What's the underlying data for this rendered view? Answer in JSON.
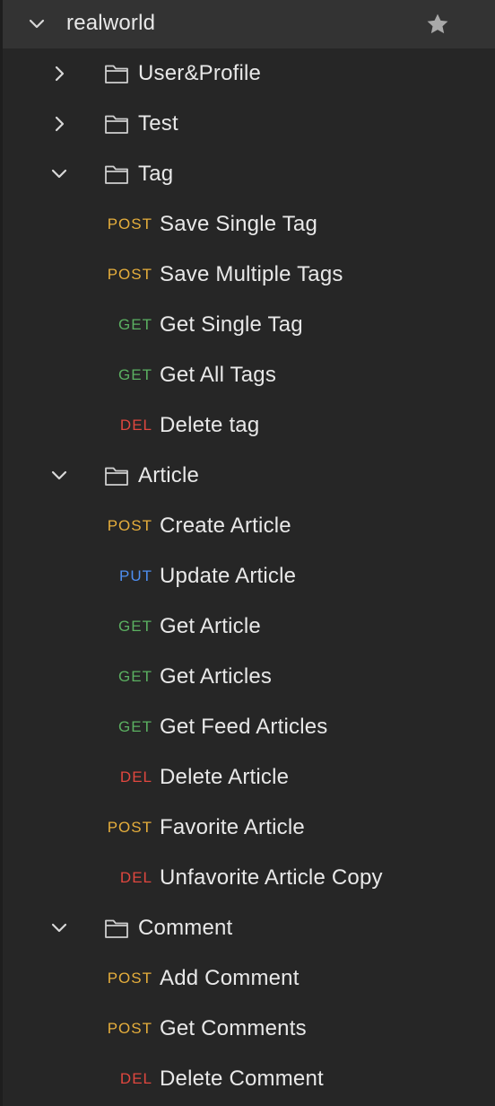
{
  "collection": {
    "name": "realworld",
    "expanded": true,
    "chevron_icon": "chevron-down-icon",
    "star_icon": "star-icon"
  },
  "colors": {
    "background": "#262626",
    "collection_row_bg": "#333333",
    "text": "#e8e8e8",
    "POST": "#e6ae3c",
    "GET": "#5bb061",
    "PUT": "#4d8ef0",
    "DEL": "#e0473f"
  },
  "folders": [
    {
      "name": "User&Profile",
      "expanded": false,
      "requests": []
    },
    {
      "name": "Test",
      "expanded": false,
      "requests": []
    },
    {
      "name": "Tag",
      "expanded": true,
      "requests": [
        {
          "method": "POST",
          "name": "Save Single Tag"
        },
        {
          "method": "POST",
          "name": "Save Multiple Tags"
        },
        {
          "method": "GET",
          "name": "Get Single Tag"
        },
        {
          "method": "GET",
          "name": "Get All Tags"
        },
        {
          "method": "DEL",
          "name": "Delete tag"
        }
      ]
    },
    {
      "name": "Article",
      "expanded": true,
      "requests": [
        {
          "method": "POST",
          "name": "Create Article"
        },
        {
          "method": "PUT",
          "name": "Update Article"
        },
        {
          "method": "GET",
          "name": "Get Article"
        },
        {
          "method": "GET",
          "name": "Get Articles"
        },
        {
          "method": "GET",
          "name": "Get Feed Articles"
        },
        {
          "method": "DEL",
          "name": "Delete Article"
        },
        {
          "method": "POST",
          "name": "Favorite Article"
        },
        {
          "method": "DEL",
          "name": "Unfavorite Article Copy"
        }
      ]
    },
    {
      "name": "Comment",
      "expanded": true,
      "requests": [
        {
          "method": "POST",
          "name": "Add Comment"
        },
        {
          "method": "POST",
          "name": "Get Comments"
        },
        {
          "method": "DEL",
          "name": "Delete Comment"
        }
      ]
    }
  ]
}
